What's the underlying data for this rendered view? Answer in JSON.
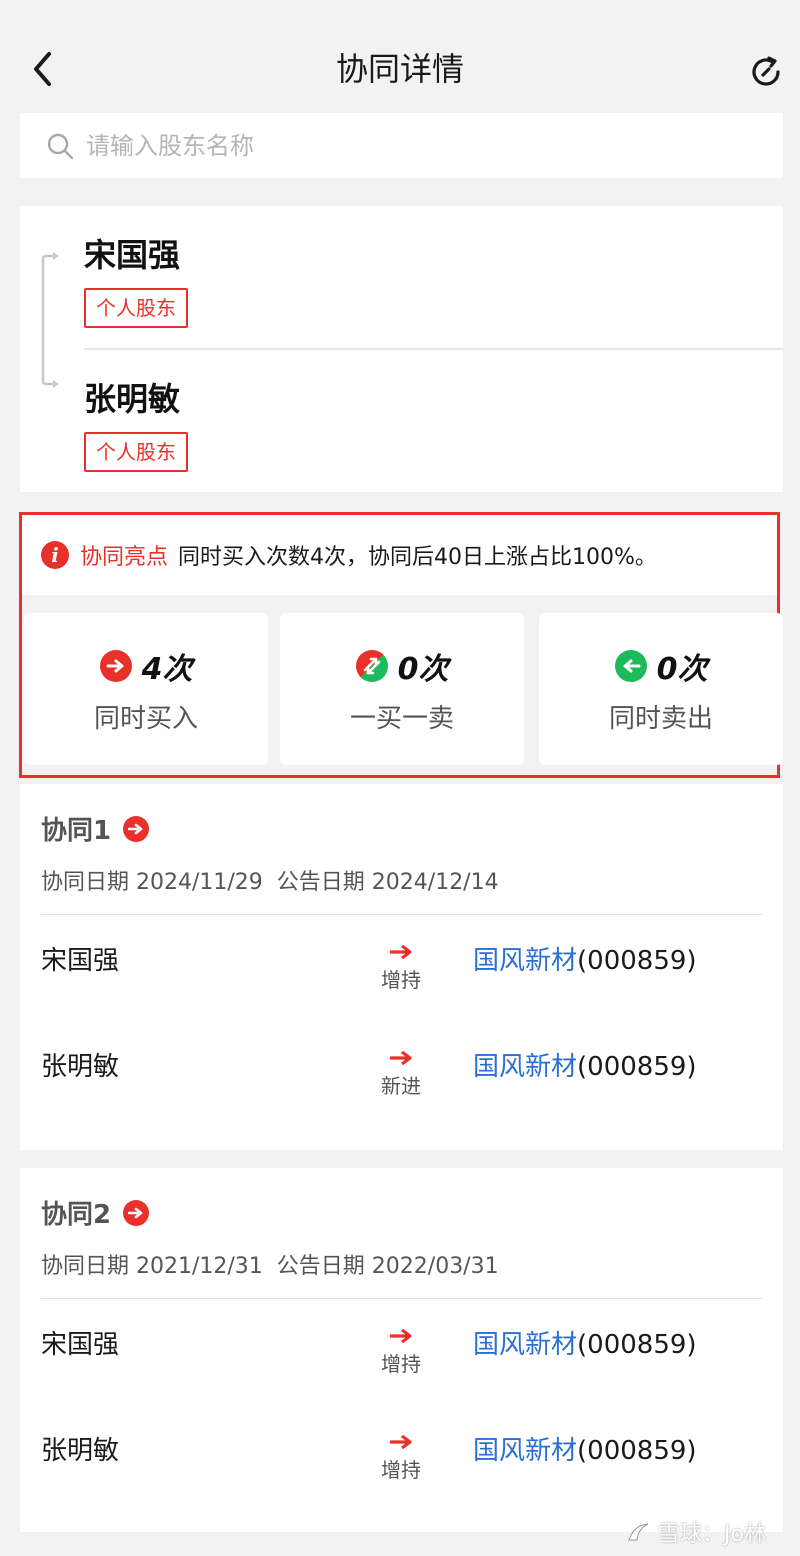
{
  "header": {
    "title": "协同详情"
  },
  "search": {
    "placeholder": "请输入股东名称"
  },
  "holders": [
    {
      "name": "宋国强",
      "tag": "个人股东"
    },
    {
      "name": "张明敏",
      "tag": "个人股东"
    }
  ],
  "highlight": {
    "label": "协同亮点",
    "text": "同时买入次数4次，协同后40日上涨占比100%。"
  },
  "stats": [
    {
      "count": "4次",
      "label": "同时买入",
      "icon": "arrow-right-circle-icon",
      "color": "#e8312a"
    },
    {
      "count": "0次",
      "label": "一买一卖",
      "icon": "buy-sell-split-icon",
      "color": "#e8312a"
    },
    {
      "count": "0次",
      "label": "同时卖出",
      "icon": "arrow-left-circle-icon",
      "color": "#1cba5b"
    }
  ],
  "groups": [
    {
      "title": "协同1",
      "date_label": "协同日期 2024/11/29",
      "announce_label": "公告日期 2024/12/14",
      "rows": [
        {
          "name": "宋国强",
          "action": "增持",
          "stock_name": "国风新材",
          "stock_code": "(000859)"
        },
        {
          "name": "张明敏",
          "action": "新进",
          "stock_name": "国风新材",
          "stock_code": "(000859)"
        }
      ]
    },
    {
      "title": "协同2",
      "date_label": "协同日期 2021/12/31",
      "announce_label": "公告日期 2022/03/31",
      "rows": [
        {
          "name": "宋国强",
          "action": "增持",
          "stock_name": "国风新材",
          "stock_code": "(000859)"
        },
        {
          "name": "张明敏",
          "action": "增持",
          "stock_name": "国风新材",
          "stock_code": "(000859)"
        }
      ]
    }
  ],
  "watermark": {
    "text": "雪球：Jo林"
  },
  "colors": {
    "accent_red": "#e8312a",
    "accent_green": "#1cba5b",
    "link_blue": "#2b6fd6"
  }
}
